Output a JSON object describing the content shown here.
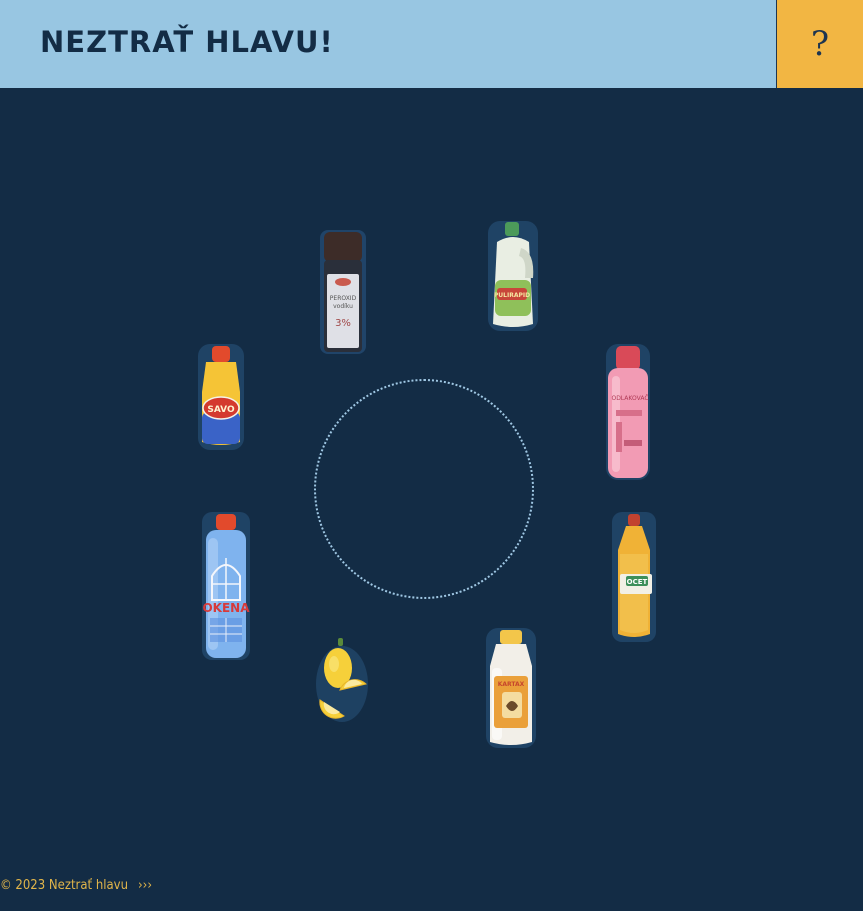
{
  "header": {
    "title": "NEZTRAŤ HLAVU!",
    "help_label": "?"
  },
  "items": [
    {
      "name": "peroxid-bottle",
      "label_line1": "PEROXID",
      "label_line2": "vodíku",
      "label_value": "3%"
    },
    {
      "name": "pulirapid-bottle",
      "label": "PULIRAPID"
    },
    {
      "name": "odlakovac-bottle",
      "label": "ODLAKOVAČ"
    },
    {
      "name": "ocet-bottle",
      "label": "OCET"
    },
    {
      "name": "savo-bottle",
      "label": "SAVO"
    },
    {
      "name": "okena-bottle",
      "label": "OKENA"
    },
    {
      "name": "lemon",
      "label": ""
    },
    {
      "name": "kartax-bottle",
      "label": "KARTAX"
    }
  ],
  "footer": {
    "copyright": "© 2023 Neztrať hlavu",
    "arrows": "›››"
  },
  "colors": {
    "background": "#132c45",
    "header": "#98c6e2",
    "help": "#f2b643",
    "footer_text": "#e1b54a",
    "drop_zone": "#9fc7e3"
  }
}
